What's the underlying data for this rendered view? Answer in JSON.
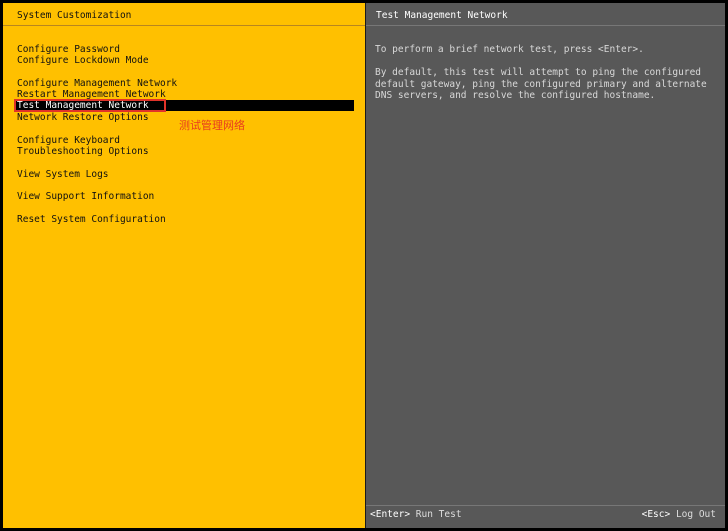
{
  "left": {
    "title": "System Customization",
    "menu": [
      {
        "label": "Configure Password"
      },
      {
        "label": "Configure Lockdown Mode"
      },
      {
        "label": "Configure Management Network"
      },
      {
        "label": "Restart Management Network"
      },
      {
        "label": "Test Management Network"
      },
      {
        "label": "Network Restore Options"
      },
      {
        "label": "Configure Keyboard"
      },
      {
        "label": "Troubleshooting Options"
      },
      {
        "label": "View System Logs"
      },
      {
        "label": "View Support Information"
      },
      {
        "label": "Reset System Configuration"
      }
    ],
    "annotation": "测试管理网络"
  },
  "right": {
    "title": "Test Management Network",
    "description": [
      "To perform a brief network test, press <Enter>.",
      "By default, this test will attempt to ping the configured",
      "default gateway, ping the configured primary and alternate",
      "DNS servers, and resolve the configured hostname."
    ],
    "footer": {
      "enter_key": "<Enter>",
      "enter_label": "Run Test",
      "esc_key": "<Esc>",
      "esc_label": "Log Out"
    }
  },
  "colors": {
    "left_bg": "#ffc000",
    "right_bg": "#585858",
    "selection_bg": "#000000",
    "annotation": "#e83a1f"
  }
}
